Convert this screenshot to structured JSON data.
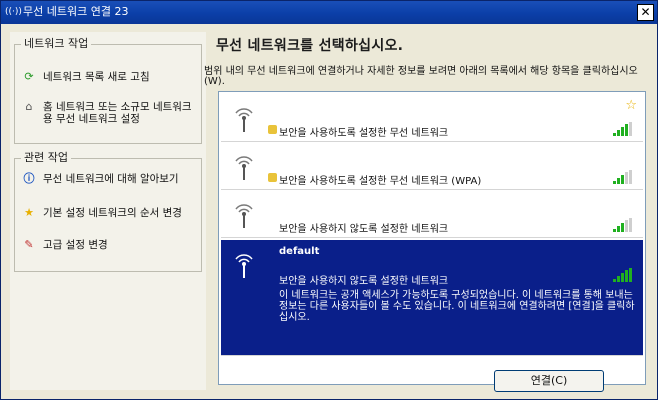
{
  "window": {
    "title": "무선 네트워크 연결 23",
    "close_glyph": "✕"
  },
  "sidebar": {
    "network_tasks": {
      "title": "네트워크 작업",
      "items": [
        {
          "label": "네트워크 목록 새로 고침",
          "icon": "refresh-icon"
        },
        {
          "label": "홈 네트워크 또는 소규모 네트워크용 무선 네트워크 설정",
          "icon": "home-network-icon"
        }
      ]
    },
    "related_tasks": {
      "title": "관련 작업",
      "items": [
        {
          "label": "무선 네트워크에 대해 알아보기",
          "icon": "info-icon"
        },
        {
          "label": "기본 설정 네트워크의 순서 변경",
          "icon": "star-icon"
        },
        {
          "label": "고급 설정 변경",
          "icon": "advanced-settings-icon"
        }
      ]
    }
  },
  "main": {
    "heading": "무선 네트워크를 선택하십시오.",
    "instructions": "범위 내의 무선 네트워크에 연결하거나 자세한 정보를 보려면 아래의 목록에서 해당 항목을 클릭하십시오(W).",
    "networks": [
      {
        "ssid": "",
        "status": "보안을 사용하도록 설정한 무선 네트워크",
        "secured": true,
        "preferred": true,
        "signal": 4,
        "selected": false
      },
      {
        "ssid": "",
        "status": "보안을 사용하도록 설정한 무선 네트워크 (WPA)",
        "secured": true,
        "preferred": false,
        "signal": 3,
        "selected": false
      },
      {
        "ssid": "",
        "status": "보안을 사용하지 않도록 설정한 네트워크",
        "secured": false,
        "preferred": false,
        "signal": 3,
        "selected": false
      },
      {
        "ssid": "default",
        "status": "보안을 사용하지 않도록 설정한 네트워크",
        "secured": false,
        "preferred": false,
        "signal": 5,
        "selected": true,
        "description": "이 네트워크는 공개 액세스가 가능하도록 구성되었습니다. 이 네트워크를 통해 보내는 정보는 다른 사용자들이 볼 수도 있습니다. 이 네트워크에 연결하려면 [연결]을 클릭하십시오."
      }
    ],
    "connect_label": "연결(C)"
  },
  "colors": {
    "titlebar": "#0b3fa8",
    "selection": "#0a1f8a",
    "signal_on": "#20b020",
    "lock": "#e9c33a"
  }
}
